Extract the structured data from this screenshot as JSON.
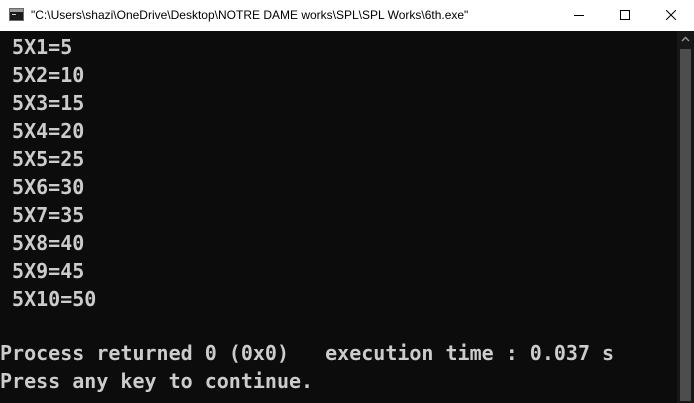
{
  "window": {
    "title": "\"C:\\Users\\shazi\\OneDrive\\Desktop\\NOTRE DAME works\\SPL\\SPL Works\\6th.exe\""
  },
  "console": {
    "lines": [
      " 5X1=5",
      " 5X2=10",
      " 5X3=15",
      " 5X4=20",
      " 5X5=25",
      " 5X6=30",
      " 5X7=35",
      " 5X8=40",
      " 5X9=45",
      " 5X10=50",
      "",
      "Process returned 0 (0x0)   execution time : 0.037 s",
      "Press any key to continue."
    ]
  },
  "colors": {
    "console_background": "#0c0c0c",
    "console_text": "#cccccc",
    "titlebar_background": "#ffffff"
  },
  "icons": {
    "app": "console-app-icon",
    "minimize": "minimize-icon",
    "maximize": "maximize-icon",
    "close": "close-icon",
    "scroll_up": "chevron-up-icon"
  }
}
